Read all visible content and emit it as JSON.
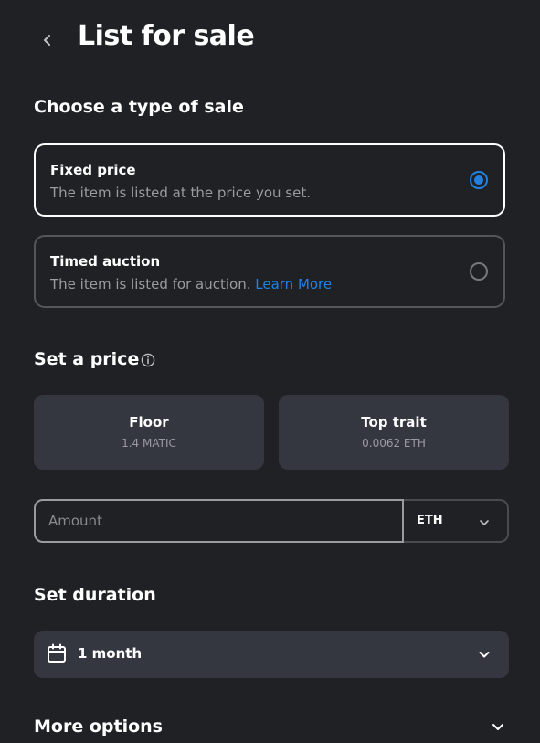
{
  "header": {
    "title": "List for sale"
  },
  "sale_type": {
    "heading": "Choose a type of sale",
    "options": [
      {
        "title": "Fixed price",
        "description": "The item is listed at the price you set.",
        "selected": true
      },
      {
        "title": "Timed auction",
        "description": "The item is listed for auction.",
        "link": "Learn More",
        "selected": false
      }
    ]
  },
  "price": {
    "heading": "Set a price",
    "cards": [
      {
        "title": "Floor",
        "value": "1.4 MATIC"
      },
      {
        "title": "Top trait",
        "value": "0.0062 ETH"
      }
    ],
    "amount_placeholder": "Amount",
    "amount_value": "",
    "currency": "ETH"
  },
  "duration": {
    "heading": "Set duration",
    "value": "1 month"
  },
  "more_options": {
    "label": "More options"
  },
  "colors": {
    "background": "#202124",
    "card": "#353740",
    "accent": "#2081e2",
    "muted_text": "#9a9ba1"
  }
}
